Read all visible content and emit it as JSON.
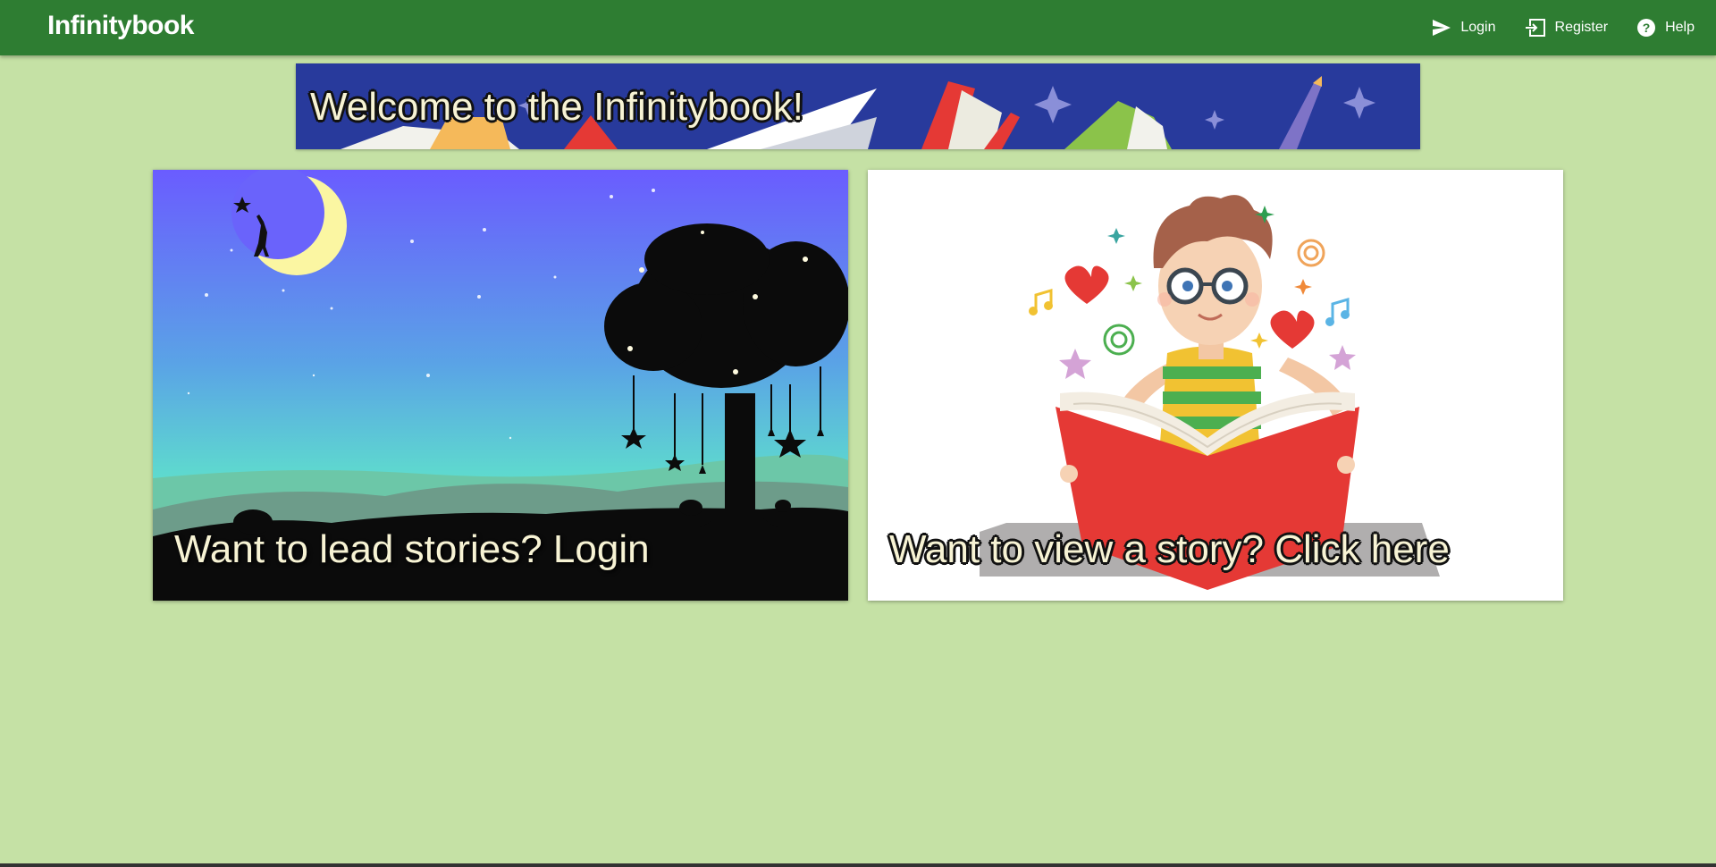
{
  "app": {
    "brand": "Infinitybook"
  },
  "nav": {
    "items": [
      {
        "label": "Login",
        "icon": "send-icon"
      },
      {
        "label": "Register",
        "icon": "login-icon"
      },
      {
        "label": "Help",
        "icon": "help-circle-icon"
      }
    ]
  },
  "banner": {
    "title": "Welcome to the Infinitybook!"
  },
  "cards": {
    "lead": {
      "caption": "Want to lead stories? Login"
    },
    "view": {
      "caption": "Want to view a story? Click here"
    }
  },
  "colors": {
    "topbar": "#2e7d32",
    "background": "#c5e1a5",
    "banner": "#283a9c"
  }
}
